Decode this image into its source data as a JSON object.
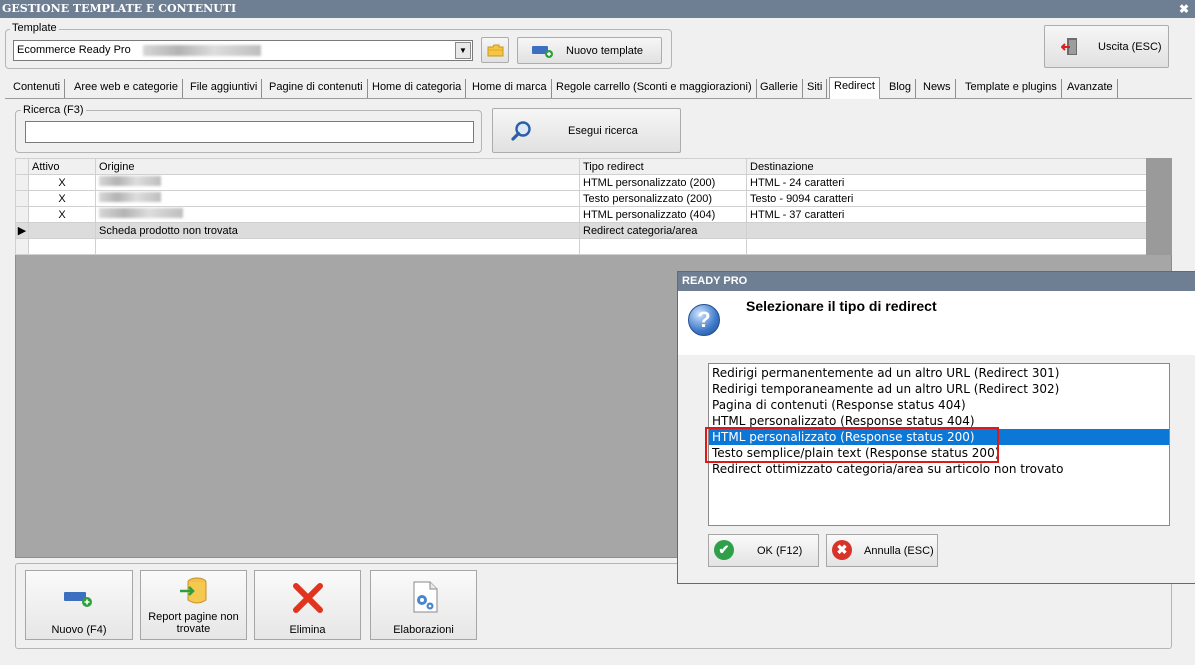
{
  "window": {
    "title": "GESTIONE TEMPLATE E CONTENUTI",
    "close_glyph": "✖"
  },
  "template": {
    "group_label": "Template",
    "selected_value": "Ecommerce Ready Pro",
    "folder_icon": "folder-icon",
    "new_template_label": "Nuovo template"
  },
  "exit_button": {
    "label": "Uscita (ESC)",
    "icon": "exit-door-icon"
  },
  "tabs": [
    {
      "label": "Contenuti"
    },
    {
      "label": "Aree web e categorie"
    },
    {
      "label": "File aggiuntivi"
    },
    {
      "label": "Pagine di contenuti"
    },
    {
      "label": "Home di categoria"
    },
    {
      "label": "Home di marca"
    },
    {
      "label": "Regole carrello (Sconti e maggiorazioni)"
    },
    {
      "label": "Gallerie"
    },
    {
      "label": "Siti"
    },
    {
      "label": "Redirect"
    },
    {
      "label": "Blog"
    },
    {
      "label": "News"
    },
    {
      "label": "Template e plugins"
    },
    {
      "label": "Avanzate"
    }
  ],
  "active_tab": "Redirect",
  "search": {
    "label": "Ricerca (F3)",
    "value": "",
    "button_label": "Esegui ricerca"
  },
  "grid": {
    "columns": [
      "Attivo",
      "Origine",
      "Tipo redirect",
      "Destinazione"
    ],
    "rows": [
      {
        "attivo": "X",
        "origine": "",
        "tipo": "HTML personalizzato (200)",
        "destinazione": "HTML - 24 caratteri"
      },
      {
        "attivo": "X",
        "origine": "",
        "tipo": "Testo personalizzato (200)",
        "destinazione": "Testo - 9094 caratteri"
      },
      {
        "attivo": "X",
        "origine": "",
        "tipo": "HTML personalizzato (404)",
        "destinazione": "HTML - 37 caratteri"
      },
      {
        "attivo": "",
        "origine": "Scheda prodotto non trovata",
        "tipo": "Redirect categoria/area",
        "destinazione": ""
      }
    ],
    "selected_row_index": 3
  },
  "toolbar": {
    "new_label": "Nuovo (F4)",
    "report_label_1": "Report pagine non",
    "report_label_2": "trovate",
    "delete_label": "Elimina",
    "process_label": "Elaborazioni"
  },
  "dialog": {
    "title": "READY PRO",
    "message": "Selezionare il tipo di redirect",
    "options": [
      "Redirigi permanentemente ad un altro URL (Redirect 301)",
      "Redirigi temporaneamente ad un altro URL (Redirect 302)",
      "Pagina di contenuti (Response status 404)",
      "HTML personalizzato (Response status 404)",
      "HTML personalizzato (Response status 200)",
      "Testo semplice/plain text (Response status 200)",
      "Redirect ottimizzato categoria/area su articolo non trovato"
    ],
    "selected_index": 4,
    "ok_label": "OK (F12)",
    "cancel_label": "Annulla (ESC)"
  },
  "colors": {
    "titlebar": "#6f7f93",
    "selection": "#0b78d7",
    "highlight_box": "#e01818",
    "grid_empty": "#a6a6a6"
  }
}
